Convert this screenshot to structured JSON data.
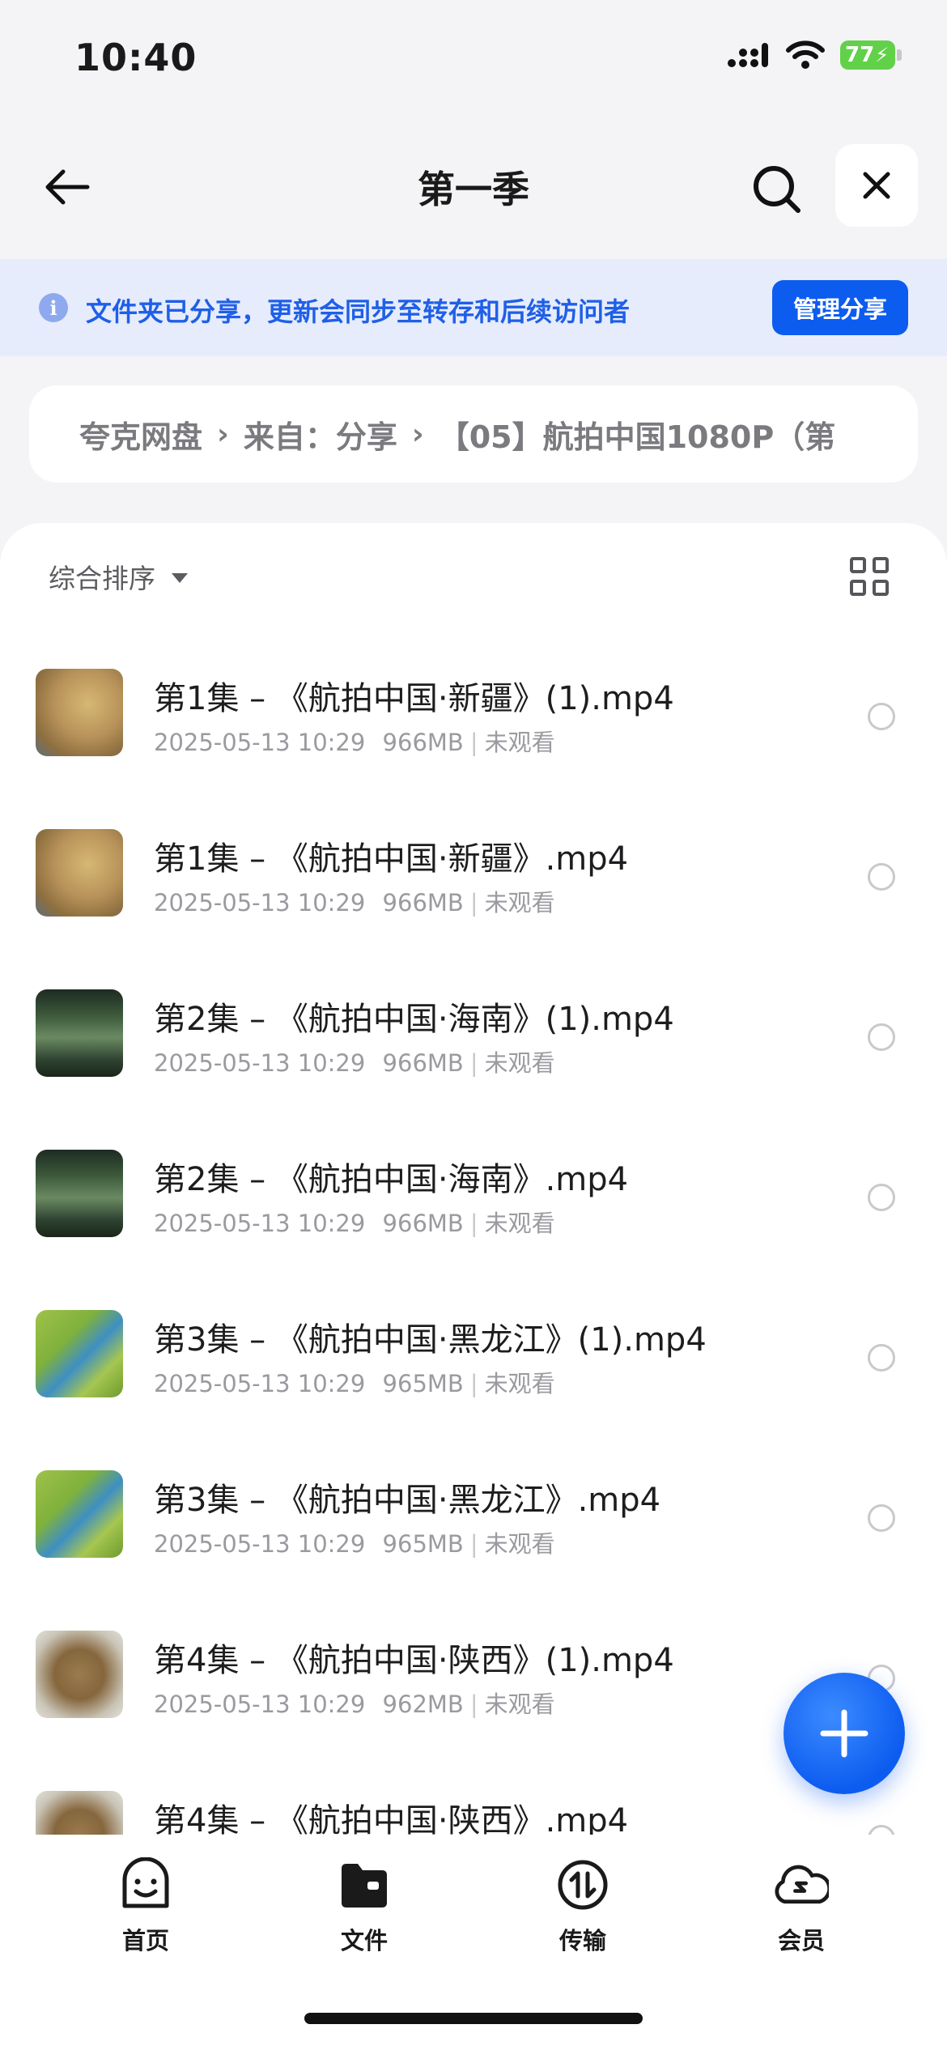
{
  "status_bar": {
    "time": "10:40",
    "battery": "77"
  },
  "nav": {
    "title": "第一季"
  },
  "share_banner": {
    "text": "文件夹已分享，更新会同步至转存和后续访问者",
    "manage_label": "管理分享"
  },
  "breadcrumb": {
    "items": [
      "夸克网盘",
      "来自：分享",
      "【05】航拍中国1080P（第"
    ]
  },
  "sort": {
    "label": "综合排序"
  },
  "files": [
    {
      "name": "第1集 – 《航拍中国·新疆》(1).mp4",
      "date": "2025-05-13 10:29",
      "size": "966MB",
      "status": "未观看",
      "thumb": "xinjiang"
    },
    {
      "name": "第1集 – 《航拍中国·新疆》.mp4",
      "date": "2025-05-13 10:29",
      "size": "966MB",
      "status": "未观看",
      "thumb": "xinjiang"
    },
    {
      "name": "第2集 – 《航拍中国·海南》(1).mp4",
      "date": "2025-05-13 10:29",
      "size": "966MB",
      "status": "未观看",
      "thumb": "hainan"
    },
    {
      "name": "第2集 – 《航拍中国·海南》.mp4",
      "date": "2025-05-13 10:29",
      "size": "966MB",
      "status": "未观看",
      "thumb": "hainan"
    },
    {
      "name": "第3集 – 《航拍中国·黑龙江》(1).mp4",
      "date": "2025-05-13 10:29",
      "size": "965MB",
      "status": "未观看",
      "thumb": "heilongjiang"
    },
    {
      "name": "第3集 – 《航拍中国·黑龙江》.mp4",
      "date": "2025-05-13 10:29",
      "size": "965MB",
      "status": "未观看",
      "thumb": "heilongjiang"
    },
    {
      "name": "第4集 – 《航拍中国·陕西》(1).mp4",
      "date": "2025-05-13 10:29",
      "size": "962MB",
      "status": "未观看",
      "thumb": "shaanxi"
    },
    {
      "name": "第4集 – 《航拍中国·陕西》.mp4",
      "date": "",
      "size": "",
      "status": "",
      "thumb": "shaanxi"
    }
  ],
  "tabs": [
    {
      "label": "首页",
      "icon": "smile-face-icon"
    },
    {
      "label": "文件",
      "icon": "folder-icon"
    },
    {
      "label": "传输",
      "icon": "transfer-icon"
    },
    {
      "label": "会员",
      "icon": "cloud-member-icon"
    }
  ],
  "colors": {
    "accent": "#0d5cf0",
    "banner_bg": "#e6ecfb",
    "banner_text": "#1f5fe8"
  }
}
